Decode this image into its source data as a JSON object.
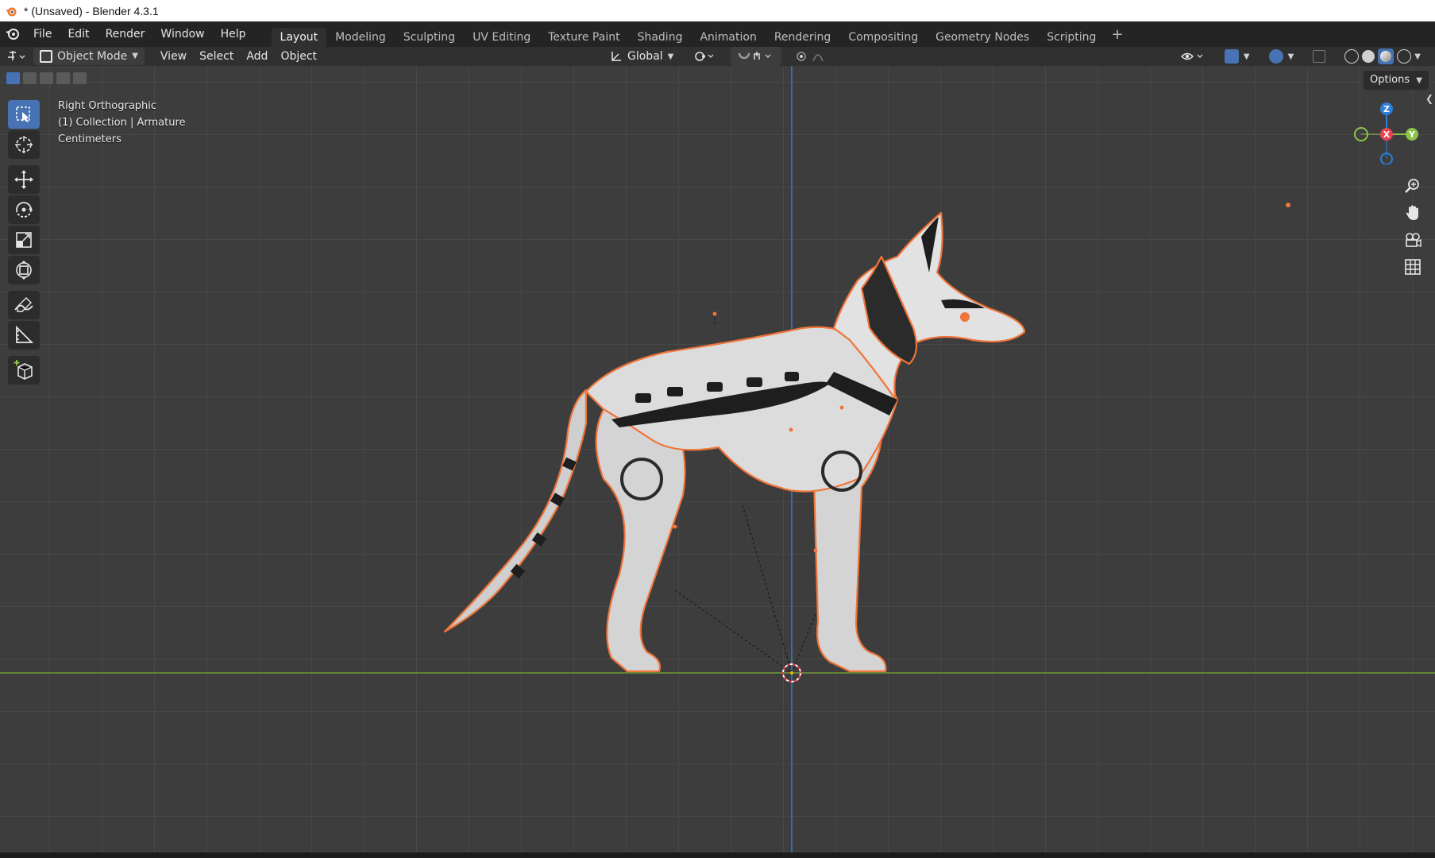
{
  "window": {
    "title": "* (Unsaved) - Blender 4.3.1"
  },
  "menus": [
    "File",
    "Edit",
    "Render",
    "Window",
    "Help"
  ],
  "workspace_tabs": [
    "Layout",
    "Modeling",
    "Sculpting",
    "UV Editing",
    "Texture Paint",
    "Shading",
    "Animation",
    "Rendering",
    "Compositing",
    "Geometry Nodes",
    "Scripting"
  ],
  "workspace_active": "Layout",
  "header": {
    "mode": "Object Mode",
    "menus": [
      "View",
      "Select",
      "Add",
      "Object"
    ],
    "orientation": "Global"
  },
  "viewport": {
    "view_name": "Right Orthographic",
    "collection": "(1) Collection | Armature",
    "units": "Centimeters",
    "options_label": "Options"
  },
  "gizmo": {
    "z": "Z",
    "x": "X",
    "y": "Y"
  },
  "colors": {
    "accent": "#4772b3",
    "selection_outline": "#f0753a",
    "axis_x": "#e8424e",
    "axis_y": "#8bc34a",
    "axis_z": "#2f7fd6",
    "ground_line": "#6e9a3a"
  },
  "icons": {
    "tools": [
      "select-box-icon",
      "cursor-icon",
      "move-icon",
      "rotate-icon",
      "scale-icon",
      "transform-icon",
      "annotate-icon",
      "measure-icon",
      "add-cube-icon"
    ],
    "nav": [
      "zoom-icon",
      "pan-hand-icon",
      "camera-icon",
      "grid-toggle-icon"
    ]
  }
}
